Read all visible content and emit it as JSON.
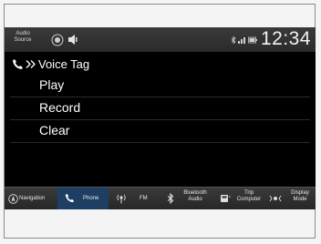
{
  "status_bar": {
    "audio_source_label": "Audio Source",
    "clock": "12:34"
  },
  "menu": {
    "title": "Voice Tag",
    "items": [
      {
        "label": "Play"
      },
      {
        "label": "Record"
      },
      {
        "label": "Clear"
      }
    ]
  },
  "bottom_nav": {
    "items": [
      {
        "label": "Navigation",
        "icon": "navigation-icon",
        "active": false
      },
      {
        "label": "Phone",
        "icon": "phone-icon",
        "active": true
      },
      {
        "label": "FM",
        "icon": "fm-radio-icon",
        "active": false
      },
      {
        "label": "Bluetooth Audio",
        "icon": "bluetooth-icon",
        "active": false
      },
      {
        "label": "Trip Computer",
        "icon": "trip-computer-icon",
        "active": false
      },
      {
        "label": "Display Mode",
        "icon": "display-mode-icon",
        "active": false
      }
    ]
  },
  "colors": {
    "screen_bg": "#000000",
    "bar_bg": "#2e2e2e",
    "active_tab": "#1e3f63",
    "text": "#ffffff"
  }
}
